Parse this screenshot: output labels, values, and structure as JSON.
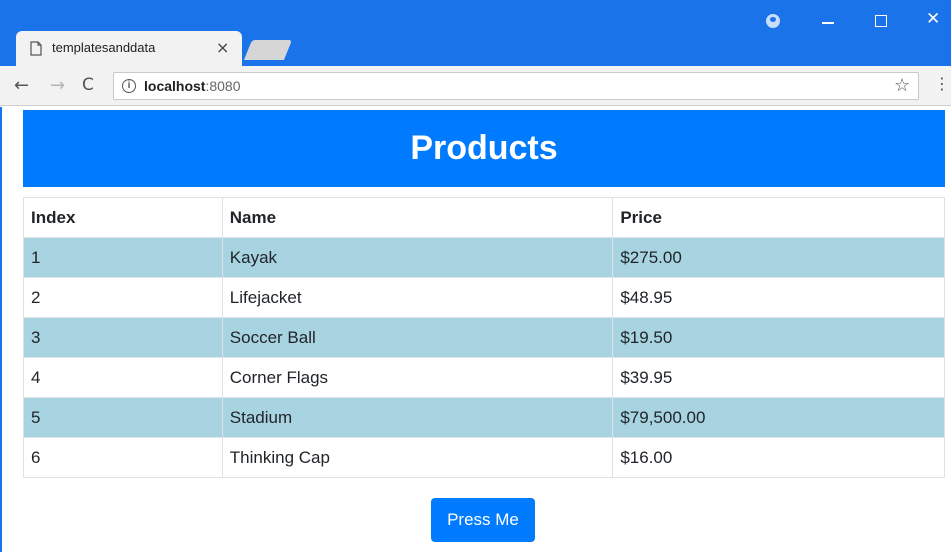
{
  "browser": {
    "tab_title": "templatesanddata",
    "tab_close": "×",
    "url_host": "localhost",
    "url_port": ":8080",
    "back_icon": "←",
    "forward_icon": "→",
    "reload_icon": "C",
    "star_icon": "☆",
    "menu_icon": "⋮",
    "close_window_icon": "✕"
  },
  "page": {
    "title": "Products",
    "table": {
      "headers": [
        "Index",
        "Name",
        "Price"
      ],
      "rows": [
        [
          "1",
          "Kayak",
          "$275.00"
        ],
        [
          "2",
          "Lifejacket",
          "$48.95"
        ],
        [
          "3",
          "Soccer Ball",
          "$19.50"
        ],
        [
          "4",
          "Corner Flags",
          "$39.95"
        ],
        [
          "5",
          "Stadium",
          "$79,500.00"
        ],
        [
          "6",
          "Thinking Cap",
          "$16.00"
        ]
      ]
    },
    "button_label": "Press Me"
  },
  "colors": {
    "browser_blue": "#1a73e8",
    "header_blue": "#007bff",
    "striped_row": "#a8d4e2"
  }
}
